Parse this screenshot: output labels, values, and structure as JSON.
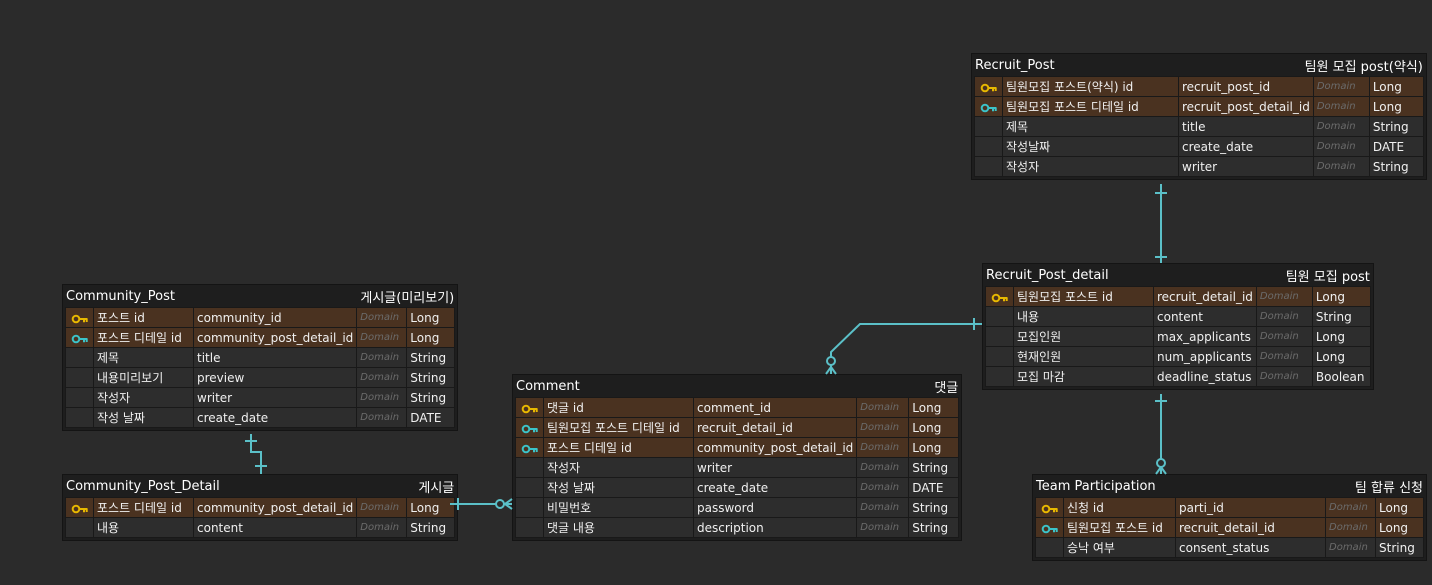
{
  "colors": {
    "background": "#2b2b2b",
    "primary_key_row": "#4a3220",
    "row": "#2d2d2d",
    "primary_key_icon": "#e8b800",
    "foreign_key_icon": "#3cc3c8",
    "relationship_line": "#5bc0c8"
  },
  "domain_placeholder": "Domain",
  "entities": [
    {
      "id": "recruit-post",
      "logical_name": "Recruit_Post",
      "physical_name": "팀원 모집 post(약식)",
      "rows": [
        {
          "key": "pk",
          "key_icon": "key-icon",
          "name": "팀원모집 포스트(약식) id",
          "column": "recruit_post_id",
          "type": "Long"
        },
        {
          "key": "fk",
          "key_icon": "key-icon",
          "name": "팀원모집 포스트 디테일 id",
          "column": "recruit_post_detail_id",
          "type": "Long"
        },
        {
          "key": "",
          "name": "제목",
          "column": "title",
          "type": "String"
        },
        {
          "key": "",
          "name": "작성날짜",
          "column": "create_date",
          "type": "DATE"
        },
        {
          "key": "",
          "name": "작성자",
          "column": "writer",
          "type": "String"
        }
      ]
    },
    {
      "id": "recruit-post-detail",
      "logical_name": "Recruit_Post_detail",
      "physical_name": "팀원 모집 post",
      "rows": [
        {
          "key": "pk",
          "key_icon": "key-icon",
          "name": "팀원모집 포스트 id",
          "column": "recruit_detail_id",
          "type": "Long"
        },
        {
          "key": "",
          "name": "내용",
          "column": "content",
          "type": "String"
        },
        {
          "key": "",
          "name": "모집인원",
          "column": "max_applicants",
          "type": "Long"
        },
        {
          "key": "",
          "name": "현재인원",
          "column": "num_applicants",
          "type": "Long"
        },
        {
          "key": "",
          "name": "모집 마감",
          "column": "deadline_status",
          "type": "Boolean"
        }
      ]
    },
    {
      "id": "community-post",
      "logical_name": "Community_Post",
      "physical_name": "게시글(미리보기)",
      "rows": [
        {
          "key": "pk",
          "key_icon": "key-icon",
          "name": "포스트 id",
          "column": "community_id",
          "type": "Long"
        },
        {
          "key": "fk",
          "key_icon": "key-icon",
          "name": "포스트 디테일 id",
          "column": "community_post_detail_id",
          "type": "Long"
        },
        {
          "key": "",
          "name": "제목",
          "column": "title",
          "type": "String"
        },
        {
          "key": "",
          "name": "내용미리보기",
          "column": "preview",
          "type": "String"
        },
        {
          "key": "",
          "name": "작성자",
          "column": "writer",
          "type": "String"
        },
        {
          "key": "",
          "name": "작성 날짜",
          "column": "create_date",
          "type": "DATE"
        }
      ]
    },
    {
      "id": "community-post-detail",
      "logical_name": "Community_Post_Detail",
      "physical_name": "게시글",
      "rows": [
        {
          "key": "pk",
          "key_icon": "key-icon",
          "name": "포스트 디테일 id",
          "column": "community_post_detail_id",
          "type": "Long"
        },
        {
          "key": "",
          "name": "내용",
          "column": "content",
          "type": "String"
        }
      ]
    },
    {
      "id": "comment",
      "logical_name": "Comment",
      "physical_name": "댓글",
      "rows": [
        {
          "key": "pk",
          "key_icon": "key-icon",
          "name": "댓글 id",
          "column": "comment_id",
          "type": "Long"
        },
        {
          "key": "fk",
          "key_icon": "key-icon",
          "name": "팀원모집 포스트 디테일 id",
          "column": "recruit_detail_id",
          "type": "Long"
        },
        {
          "key": "fk",
          "key_icon": "key-icon",
          "name": "포스트 디테일 id",
          "column": "community_post_detail_id",
          "type": "Long"
        },
        {
          "key": "",
          "name": "작성자",
          "column": "writer",
          "type": "String"
        },
        {
          "key": "",
          "name": "작성 날짜",
          "column": "create_date",
          "type": "DATE"
        },
        {
          "key": "",
          "name": "비밀번호",
          "column": "password",
          "type": "String"
        },
        {
          "key": "",
          "name": "댓글 내용",
          "column": "description",
          "type": "String"
        }
      ]
    },
    {
      "id": "team-participation",
      "logical_name": "Team Participation",
      "physical_name": "팀 합류 신청",
      "rows": [
        {
          "key": "pk",
          "key_icon": "key-icon",
          "name": "신청 id",
          "column": "parti_id",
          "type": "Long"
        },
        {
          "key": "fk",
          "key_icon": "key-icon",
          "name": "팀원모집 포스트 id",
          "column": "recruit_detail_id",
          "type": "Long"
        },
        {
          "key": "",
          "name": "승낙 여부",
          "column": "consent_status",
          "type": "String"
        }
      ]
    }
  ],
  "relationships": [
    {
      "from": "recruit-post",
      "to": "recruit-post-detail",
      "from_end": "one",
      "to_end": "one"
    },
    {
      "from": "recruit-post-detail",
      "to": "team-participation",
      "from_end": "one",
      "to_end": "zero-or-many"
    },
    {
      "from": "recruit-post-detail",
      "to": "comment",
      "from_end": "one",
      "to_end": "zero-or-many"
    },
    {
      "from": "community-post",
      "to": "community-post-detail",
      "from_end": "one",
      "to_end": "one"
    },
    {
      "from": "community-post-detail",
      "to": "comment",
      "from_end": "one",
      "to_end": "zero-or-many"
    }
  ]
}
